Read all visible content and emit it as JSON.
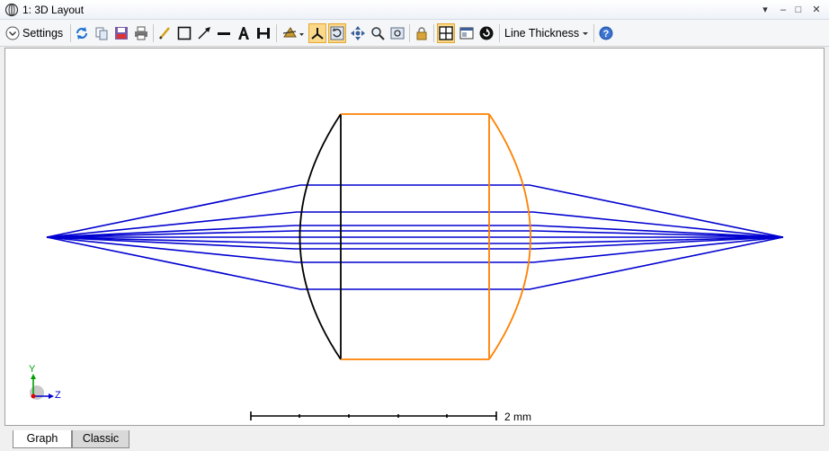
{
  "window": {
    "title": "1: 3D Layout",
    "controls": [
      "▾",
      "–",
      "□",
      "✕"
    ]
  },
  "toolbar": {
    "settings_label": "Settings",
    "line_thickness_label": "Line Thickness",
    "icons": [
      "refresh-icon",
      "copy-icon",
      "save-icon",
      "print-icon",
      "pencil-icon",
      "rectangle-icon",
      "arrow-icon",
      "line-icon",
      "text-icon",
      "dimension-icon",
      "rotate-view-icon",
      "axes-icon",
      "reset-rotation-icon",
      "pan-icon",
      "zoom-icon",
      "restore-zoom-icon",
      "lock-icon",
      "fit-view-icon",
      "window-icon",
      "auto-update-icon",
      "help-icon"
    ]
  },
  "plot": {
    "scale_label": "2 mm",
    "axis_y_label": "Y",
    "axis_z_label": "Z",
    "colors": {
      "rays": "#0000d0",
      "lens_front": "#000000",
      "lens_back": "#ff8000"
    }
  },
  "tabs": [
    {
      "label": "Graph",
      "active": true
    },
    {
      "label": "Classic",
      "active": false
    }
  ]
}
